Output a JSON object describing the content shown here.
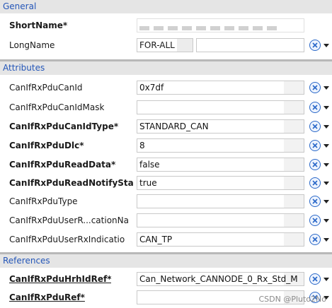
{
  "sections": {
    "general": "General",
    "attributes": "Attributes",
    "references": "References"
  },
  "general": {
    "shortname_label": "ShortName*",
    "shortname_value": "",
    "longname_label": "LongName",
    "longname_lang": "FOR-ALL",
    "longname_value": ""
  },
  "attributes": [
    {
      "label": "CanIfRxPduCanId",
      "value": "0x7df",
      "bold": false
    },
    {
      "label": "CanIfRxPduCanIdMask",
      "value": "",
      "bold": false
    },
    {
      "label": "CanIfRxPduCanIdType*",
      "value": "STANDARD_CAN",
      "bold": true
    },
    {
      "label": "CanIfRxPduDlc*",
      "value": "8",
      "bold": true
    },
    {
      "label": "CanIfRxPduReadData*",
      "value": "false",
      "bold": true
    },
    {
      "label": "CanIfRxPduReadNotifySta",
      "value": "true",
      "bold": true
    },
    {
      "label": "CanIfRxPduType",
      "value": "",
      "bold": false
    },
    {
      "label": "CanIfRxPduUserR...cationNa",
      "value": "",
      "bold": false
    },
    {
      "label": "CanIfRxPduUserRxIndicatio",
      "value": "CAN_TP",
      "bold": false
    }
  ],
  "references": [
    {
      "label": "CanIfRxPduHrhIdRef*",
      "value": "Can_Network_CANNODE_0_Rx_Std_M"
    },
    {
      "label": "CanIfRxPduRef*",
      "value": ""
    }
  ],
  "watermark": "CSDN @Pluto2No",
  "colors": {
    "section_text": "#2456b8",
    "section_bg": "#e5e5e5",
    "icon": "#2a68c8"
  },
  "icons": {
    "control": "x-circle-icon",
    "dropdown": "chevron-down-icon"
  }
}
